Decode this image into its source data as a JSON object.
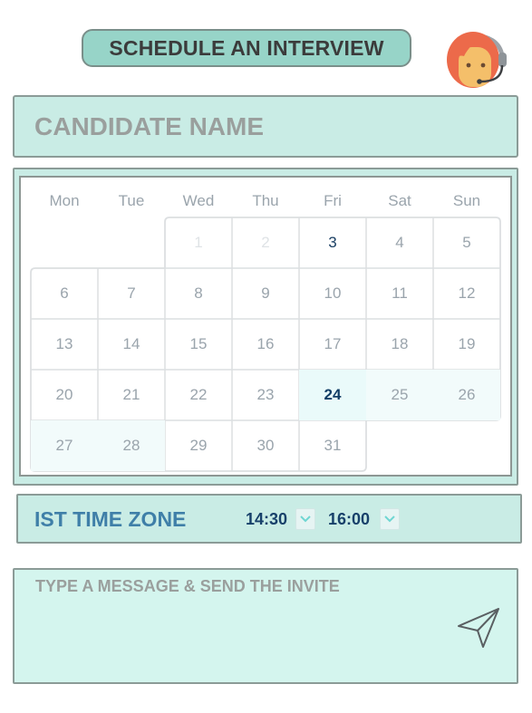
{
  "header": {
    "title": "SCHEDULE AN INTERVIEW",
    "avatar_icon": "support-agent-headset-avatar"
  },
  "candidate": {
    "placeholder": "CANDIDATE NAME",
    "value": ""
  },
  "calendar": {
    "weekdays": [
      "Mon",
      "Tue",
      "Wed",
      "Thu",
      "Fri",
      "Sat",
      "Sun"
    ],
    "weeks": [
      [
        "",
        "",
        "1",
        "2",
        "3",
        "4",
        "5"
      ],
      [
        "6",
        "7",
        "8",
        "9",
        "10",
        "11",
        "12"
      ],
      [
        "13",
        "14",
        "15",
        "16",
        "17",
        "18",
        "19"
      ],
      [
        "20",
        "21",
        "22",
        "23",
        "24",
        "25",
        "26"
      ],
      [
        "27",
        "28",
        "29",
        "30",
        "31",
        "",
        ""
      ]
    ],
    "disabled_days": [
      "1",
      "2"
    ],
    "today": "3",
    "selected_day": "24",
    "highlighted_days": [
      "25",
      "26",
      "27",
      "28"
    ]
  },
  "timezone": {
    "label": "IST TIME ZONE",
    "start_time": "14:30",
    "end_time": "16:00"
  },
  "message": {
    "placeholder": "TYPE A MESSAGE & SEND THE INVITE",
    "value": "",
    "send_icon": "paper-plane-icon"
  },
  "colors": {
    "panel": "#c9ece5",
    "title_pill": "#97d4c8",
    "message_panel": "#d4f5ee",
    "accent_blue": "#3f7fa8",
    "selected_text": "#123d66",
    "highlight_border": "#a8e6e3"
  }
}
